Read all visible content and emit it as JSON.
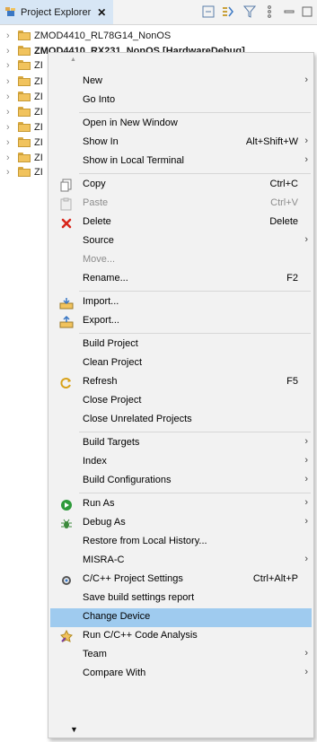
{
  "tab": {
    "title": "Project Explorer",
    "close": "✕"
  },
  "toolbar": [
    "collapse-all-icon",
    "link-with-editor-icon",
    "filter-icon",
    "view-menu-icon",
    "minimize-icon",
    "maximize-icon"
  ],
  "tree": [
    {
      "label": "ZMOD4410_RL78G14_NonOS",
      "bold": false
    },
    {
      "label": "ZMOD4410_RX231_NonOS [HardwareDebug]",
      "bold": true
    },
    {
      "label": "ZI",
      "bold": false
    },
    {
      "label": "ZI",
      "bold": false
    },
    {
      "label": "ZI",
      "bold": false
    },
    {
      "label": "ZI",
      "bold": false
    },
    {
      "label": "ZI",
      "bold": false
    },
    {
      "label": "ZI",
      "bold": false
    },
    {
      "label": "ZI",
      "bold": false
    },
    {
      "label": "ZI",
      "bold": false
    }
  ],
  "menu": {
    "scroll_up": "▲",
    "scroll_down": "▼",
    "items": [
      {
        "label": "New",
        "submenu": true
      },
      {
        "label": "Go Into"
      },
      {
        "sep": true
      },
      {
        "label": "Open in New Window"
      },
      {
        "label": "Show In",
        "shortcut": "Alt+Shift+W",
        "submenu": true
      },
      {
        "label": "Show in Local Terminal",
        "submenu": true
      },
      {
        "sep": true
      },
      {
        "label": "Copy",
        "shortcut": "Ctrl+C",
        "icon": "copy-icon"
      },
      {
        "label": "Paste",
        "shortcut": "Ctrl+V",
        "icon": "paste-icon",
        "disabled": true
      },
      {
        "label": "Delete",
        "shortcut": "Delete",
        "icon": "delete-icon"
      },
      {
        "label": "Source",
        "submenu": true
      },
      {
        "label": "Move...",
        "disabled": true
      },
      {
        "label": "Rename...",
        "shortcut": "F2"
      },
      {
        "sep": true
      },
      {
        "label": "Import...",
        "icon": "import-icon"
      },
      {
        "label": "Export...",
        "icon": "export-icon"
      },
      {
        "sep": true
      },
      {
        "label": "Build Project"
      },
      {
        "label": "Clean Project"
      },
      {
        "label": "Refresh",
        "shortcut": "F5",
        "icon": "refresh-icon"
      },
      {
        "label": "Close Project"
      },
      {
        "label": "Close Unrelated Projects"
      },
      {
        "sep": true
      },
      {
        "label": "Build Targets",
        "submenu": true
      },
      {
        "label": "Index",
        "submenu": true
      },
      {
        "label": "Build Configurations",
        "submenu": true
      },
      {
        "sep": true
      },
      {
        "label": "Run As",
        "submenu": true,
        "icon": "run-icon"
      },
      {
        "label": "Debug As",
        "submenu": true,
        "icon": "debug-icon"
      },
      {
        "label": "Restore from Local History..."
      },
      {
        "label": "MISRA-C",
        "submenu": true
      },
      {
        "label": "C/C++ Project Settings",
        "shortcut": "Ctrl+Alt+P",
        "icon": "settings-icon"
      },
      {
        "label": "Save build settings report"
      },
      {
        "label": "Change Device",
        "highlighted": true
      },
      {
        "label": "Run C/C++ Code Analysis",
        "icon": "code-analysis-icon"
      },
      {
        "label": "Team",
        "submenu": true
      },
      {
        "label": "Compare With",
        "submenu": true
      }
    ]
  },
  "colors": {
    "highlight": "#9fcbef",
    "menu_bg": "#f2f2f2",
    "tab_active": "#d7e6f5"
  }
}
